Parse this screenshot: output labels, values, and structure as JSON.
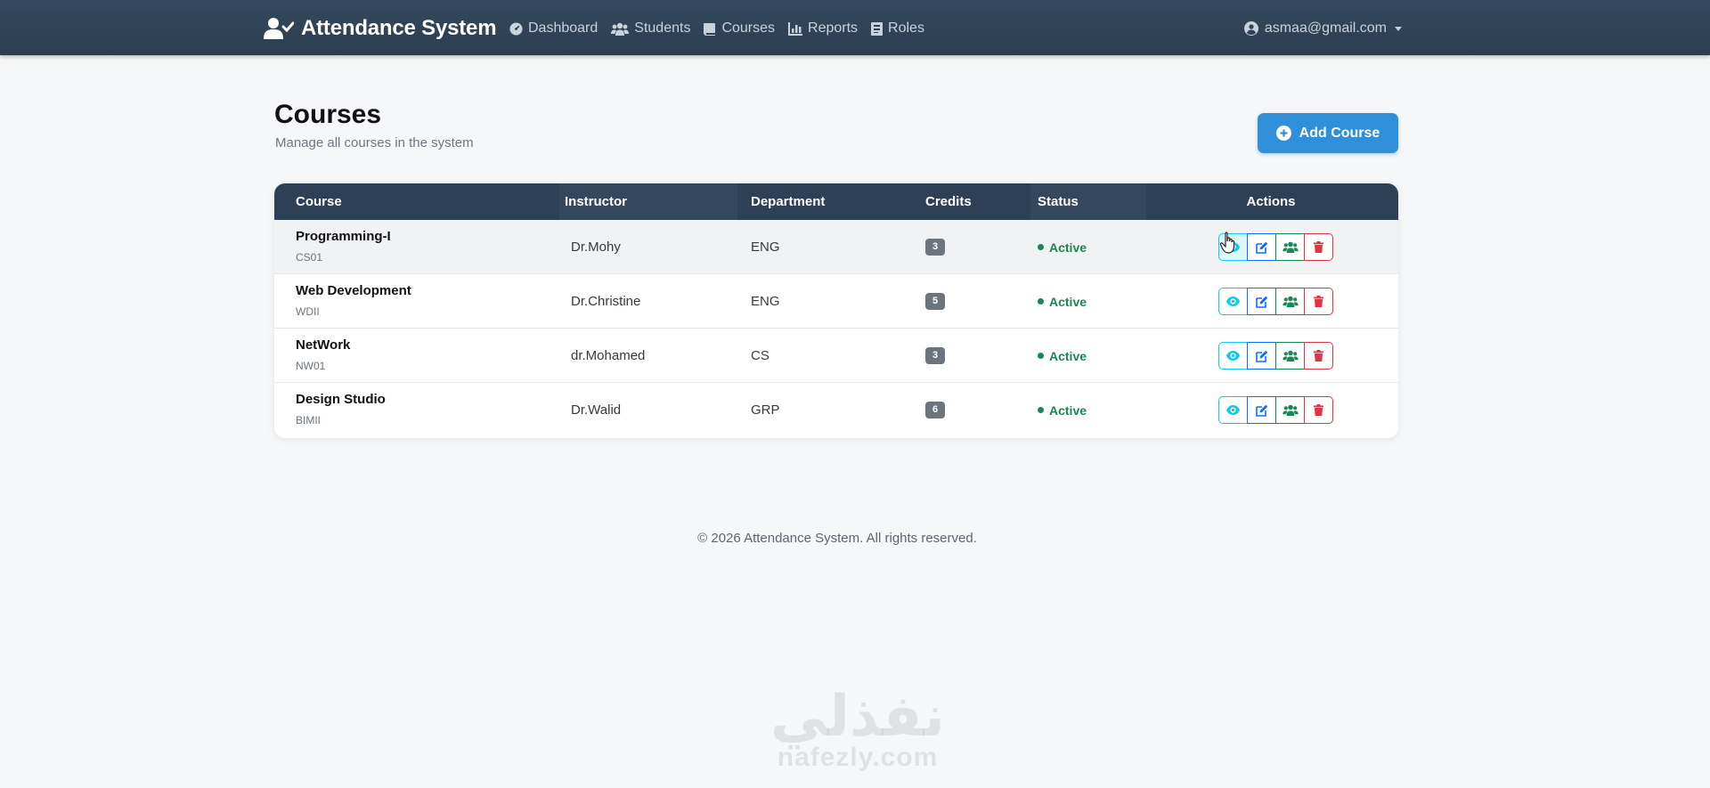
{
  "navbar": {
    "brand": "Attendance System",
    "links": [
      {
        "label": "Dashboard",
        "icon": "dashboard-icon"
      },
      {
        "label": "Students",
        "icon": "users-icon"
      },
      {
        "label": "Courses",
        "icon": "book-icon"
      },
      {
        "label": "Reports",
        "icon": "chart-icon"
      },
      {
        "label": "Roles",
        "icon": "roles-icon"
      }
    ],
    "user": "asmaa@gmail.com"
  },
  "header": {
    "title": "Courses",
    "subtitle": "Manage all courses in the system",
    "add_button": "Add Course"
  },
  "table": {
    "columns": [
      "Course",
      "Instructor",
      "Department",
      "Credits",
      "Status",
      "Actions"
    ],
    "rows": [
      {
        "name": "Programming-I",
        "code": "CS01",
        "instructor": "Dr.Mohy",
        "department": "ENG",
        "credits": "3",
        "status": "Active"
      },
      {
        "name": "Web Development",
        "code": "WDII",
        "instructor": "Dr.Christine",
        "department": "ENG",
        "credits": "5",
        "status": "Active"
      },
      {
        "name": "NetWork",
        "code": "NW01",
        "instructor": "dr.Mohamed",
        "department": "CS",
        "credits": "3",
        "status": "Active"
      },
      {
        "name": "Design Studio",
        "code": "BIMII",
        "instructor": "Dr.Walid",
        "department": "GRP",
        "credits": "6",
        "status": "Active"
      }
    ]
  },
  "footer": "© 2026 Attendance System. All rights reserved.",
  "watermark": {
    "arabic": "نفذلي",
    "latin": "nafezly.com"
  },
  "colors": {
    "navbar": "#2c3e50",
    "primary": "#2f8fd8",
    "success": "#198754",
    "info": "#0dcaf0",
    "danger": "#dc3545"
  }
}
